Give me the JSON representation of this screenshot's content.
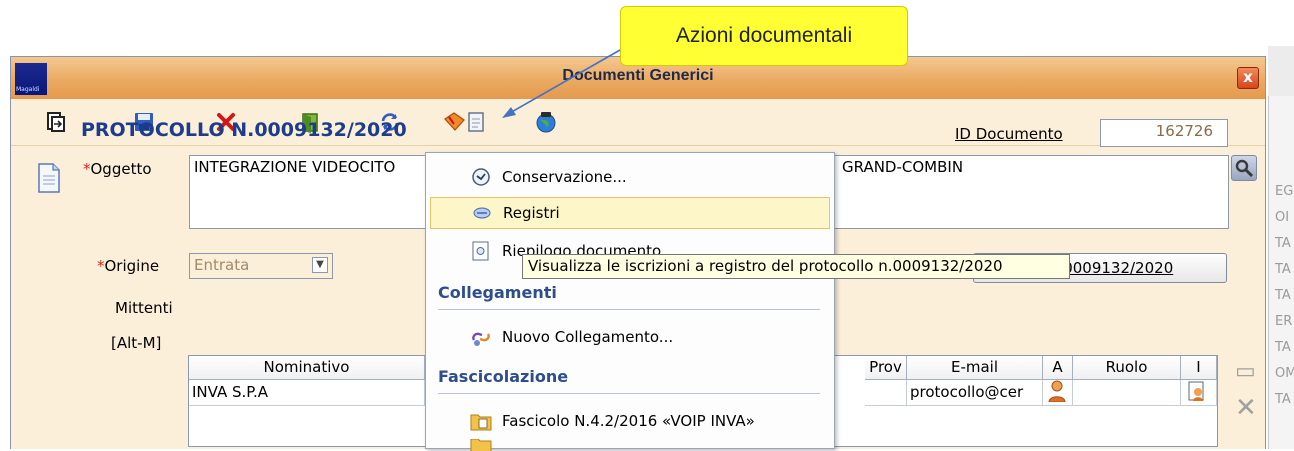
{
  "callout": {
    "text": "Azioni documentali"
  },
  "window": {
    "title": "Documenti Generici",
    "close_label": "x",
    "logo_text": "Magaldi"
  },
  "toolbar": {
    "items": [
      {
        "name": "export-icon"
      },
      {
        "name": "save-icon"
      },
      {
        "name": "delete-icon"
      },
      {
        "name": "exit-door-icon"
      },
      {
        "name": "refresh-icon"
      },
      {
        "name": "document-actions-icon"
      },
      {
        "name": "globe-icon"
      }
    ]
  },
  "document": {
    "protocol_title": "PROTOCOLLO N.0009132/2020",
    "id_label": "ID Documento",
    "id_value": "162726",
    "oggetto_label": "Oggetto",
    "oggetto_value": "INTEGRAZIONE VIDEOCITO",
    "oggetto_value_right": "GRAND-COMBIN",
    "origine_label": "Origine",
    "origine_value": "Entrata",
    "prot_button": "Prot. N.0009132/2020",
    "mittenti_label": "Mittenti",
    "alt_label": "[Alt-M]"
  },
  "grid": {
    "headers": [
      "Nominativo",
      "Prov",
      "E-mail",
      "A",
      "Ruolo",
      "I"
    ],
    "row": {
      "nominativo": "INVA S.P.A",
      "prov": "",
      "email": "protocollo@cer",
      "ruolo": ""
    }
  },
  "menu": {
    "items": [
      {
        "label": "Conservazione...",
        "icon": "clock-icon"
      },
      {
        "label": "Registri",
        "icon": "register-icon"
      },
      {
        "label": "Riepilogo documento",
        "icon": "summary-icon"
      }
    ],
    "sections": [
      {
        "title": "Collegamenti",
        "items": [
          {
            "label": "Nuovo Collegamento...",
            "icon": "link-icon"
          }
        ]
      },
      {
        "title": "Fascicolazione",
        "items": [
          {
            "label": "Fascicolo N.4.2/2016 «VOIP INVA»",
            "icon": "folder-icon"
          }
        ]
      }
    ],
    "tooltip": "Visualizza le iscrizioni a registro del protocollo n.0009132/2020"
  },
  "background_window": {
    "fragments": [
      "EG",
      "OI",
      "TA",
      "TA",
      "TA",
      "ER",
      "TA",
      "OM",
      "TA"
    ]
  },
  "colors": {
    "callout": "#ffff33",
    "titlebar": "#eaa860",
    "window_bg": "#fbefd9",
    "accent_text": "#1d3c8c",
    "required": "#e0241b"
  }
}
